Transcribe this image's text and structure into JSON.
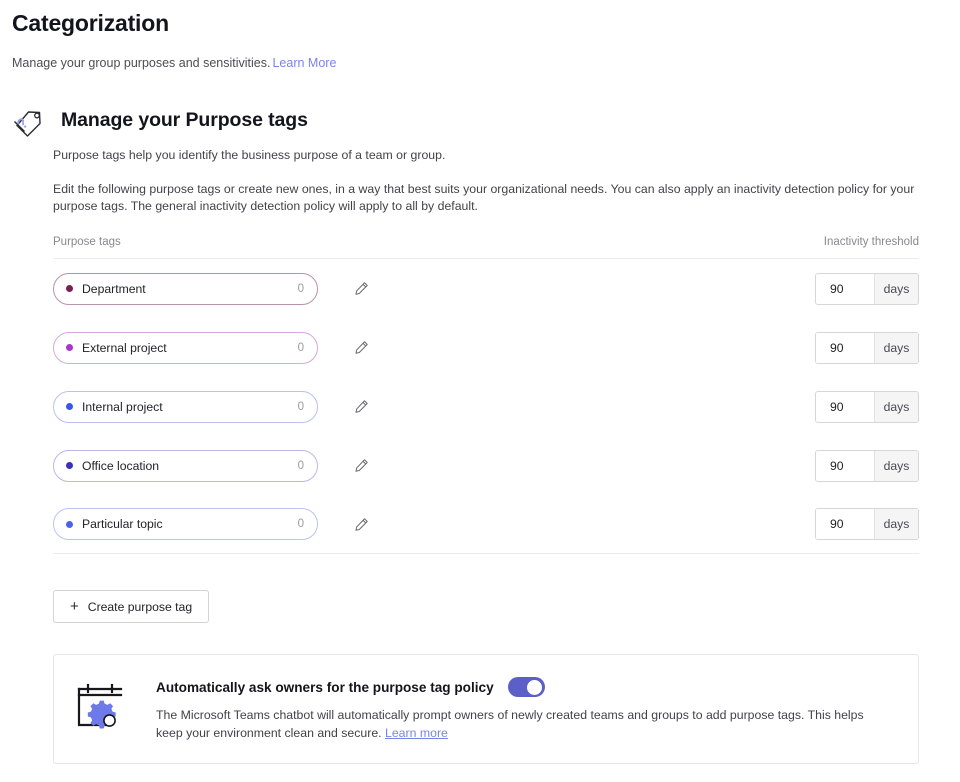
{
  "header": {
    "title": "Categorization",
    "subtitle": "Manage your group purposes and sensitivities.",
    "learn_more": "Learn More"
  },
  "section": {
    "icon": "purpose-tag-icon",
    "heading": "Manage your Purpose tags",
    "paragraphs": [
      "Purpose tags help you identify the business purpose of a team or group.",
      "Edit the following purpose tags or create new ones, in a way that best suits your organizational needs. You can also apply an inactivity detection policy for your purpose tags. The general inactivity detection policy will apply to all by default."
    ]
  },
  "table": {
    "columns": {
      "tags": "Purpose tags",
      "threshold": "Inactivity threshold"
    },
    "unit": "days",
    "rows": [
      {
        "label": "Department",
        "count": "0",
        "value": "90",
        "dot": "#7b1f52",
        "border": "#b893ab"
      },
      {
        "label": "External project",
        "count": "0",
        "value": "90",
        "dot": "#a836c8",
        "border": "#d4a9dd"
      },
      {
        "label": "Internal project",
        "count": "0",
        "value": "90",
        "dot": "#3b55e6",
        "border": "#b6c2ef"
      },
      {
        "label": "Office location",
        "count": "0",
        "value": "90",
        "dot": "#3d2fbe",
        "border": "#bdb6e3"
      },
      {
        "label": "Particular topic",
        "count": "0",
        "value": "90",
        "dot": "#4a63e8",
        "border": "#b9c4f0"
      }
    ],
    "edit_icon": "pencil-icon"
  },
  "create_button": {
    "label": "Create purpose tag",
    "plus": "+"
  },
  "policy_card": {
    "icon": "calendar-gear-icon",
    "title": "Automatically ask owners for the purpose tag policy",
    "toggle_state": "on",
    "description": "The Microsoft Teams chatbot will automatically prompt owners of newly created teams and groups to add purpose tags. This helps keep your environment clean and secure.",
    "learn_more": "Learn more"
  },
  "colors": {
    "accent": "#5b5fc7",
    "link": "#7b83eb",
    "text": "#1b1b1f"
  }
}
